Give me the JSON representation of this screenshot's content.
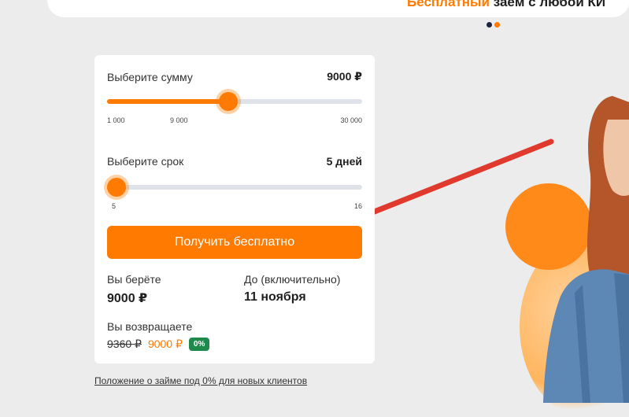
{
  "banner": {
    "accent": "Бесплатный",
    "rest": " заём с любой КИ"
  },
  "carousel": {
    "dots": [
      "active",
      "inactive"
    ]
  },
  "amount": {
    "label": "Выберите сумму",
    "value_text": "9000 ₽",
    "min": 1000,
    "max": 30000,
    "value": 9000,
    "ticks": [
      "1 000",
      "9 000",
      "30 000"
    ]
  },
  "term": {
    "label": "Выберите срок",
    "value_text": "5 дней",
    "min": 5,
    "max": 16,
    "value": 5,
    "ticks": [
      "5",
      "16"
    ]
  },
  "cta": {
    "label": "Получить бесплатно"
  },
  "summary": {
    "borrow_label": "Вы берёте",
    "borrow_value": "9000 ₽",
    "due_label": "До (включительно)",
    "due_value": "11 ноября",
    "return_label": "Вы возвращаете",
    "old_price": "9360 ₽",
    "new_price": "9000 ₽",
    "badge": "0%"
  },
  "footer": {
    "terms_link": "Положение о займе под 0% для новых клиентов"
  },
  "colors": {
    "accent": "#ff7a00",
    "badge": "#1f8a4c",
    "dot_active": "#1f2340"
  },
  "icons": {
    "pointer": "red-arrow-icon"
  }
}
